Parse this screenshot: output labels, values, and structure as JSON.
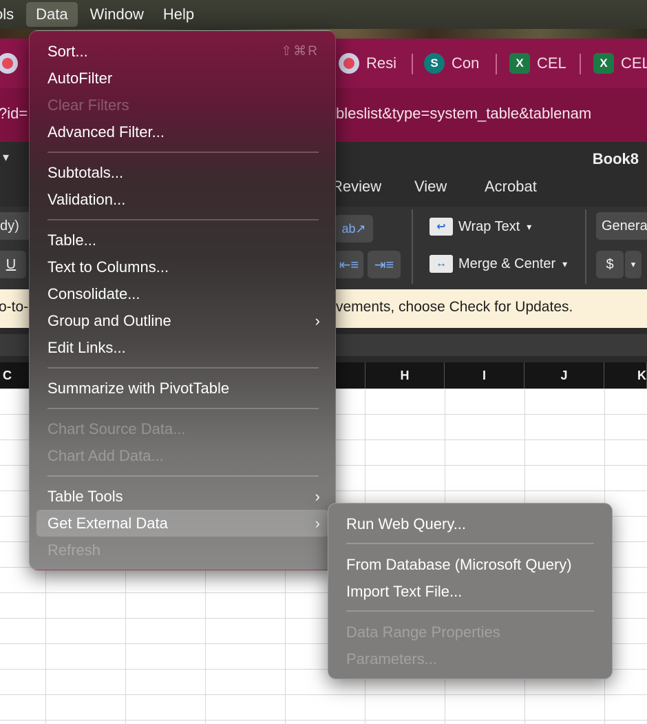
{
  "menubar": {
    "items": [
      "ols",
      "Data",
      "Window",
      "Help"
    ],
    "active_index": 1
  },
  "browser": {
    "tabs": [
      {
        "label": "",
        "icon": "app-icon"
      },
      {
        "label": "Resi",
        "icon": "app-icon"
      },
      {
        "label": "Con",
        "icon": "sharepoint-icon",
        "glyph": "S"
      },
      {
        "label": "CEL",
        "icon": "excel-icon",
        "glyph": "X"
      },
      {
        "label": "CEL",
        "icon": "excel-icon",
        "glyph": "X"
      }
    ],
    "url_left": "?id=",
    "url_right": "bleslist&type=system_table&tablenam"
  },
  "excel": {
    "title": "Book8",
    "ribbon_tabs": [
      "Review",
      "View",
      "Acrobat"
    ],
    "font_fragment": "dy)",
    "underline_label": "U",
    "wrap_text": "Wrap Text",
    "merge_center": "Merge & Center",
    "number_format": "Genera",
    "currency": "$",
    "notice_left": "o-to-",
    "notice_right": "vements, choose Check for Updates.",
    "columns": [
      "C",
      "H",
      "I",
      "J",
      "K"
    ]
  },
  "data_menu": {
    "items": [
      {
        "label": "Sort...",
        "shortcut": "⇧⌘R",
        "enabled": true
      },
      {
        "label": "AutoFilter",
        "enabled": true
      },
      {
        "label": "Clear Filters",
        "enabled": false
      },
      {
        "label": "Advanced Filter...",
        "enabled": true
      },
      {
        "label": "Subtotals...",
        "enabled": true
      },
      {
        "label": "Validation...",
        "enabled": true
      },
      {
        "label": "Table...",
        "enabled": true
      },
      {
        "label": "Text to Columns...",
        "enabled": true
      },
      {
        "label": "Consolidate...",
        "enabled": true
      },
      {
        "label": "Group and Outline",
        "enabled": true,
        "submenu": true
      },
      {
        "label": "Edit Links...",
        "enabled": true
      },
      {
        "label": "Summarize with PivotTable",
        "enabled": true
      },
      {
        "label": "Chart Source Data...",
        "enabled": false
      },
      {
        "label": "Chart Add Data...",
        "enabled": false
      },
      {
        "label": "Table Tools",
        "enabled": true,
        "submenu": true
      },
      {
        "label": "Get External Data",
        "enabled": true,
        "submenu": true,
        "highlighted": true
      },
      {
        "label": "Refresh",
        "enabled": false
      }
    ]
  },
  "external_data_submenu": {
    "items": [
      {
        "label": "Run Web Query...",
        "enabled": true
      },
      {
        "label": "From Database (Microsoft Query)",
        "enabled": true
      },
      {
        "label": "Import Text File...",
        "enabled": true
      },
      {
        "label": "Data Range Properties",
        "enabled": false
      },
      {
        "label": "Parameters...",
        "enabled": false
      }
    ]
  },
  "glyphs": {
    "chevron_right": "›",
    "chevron_down": "▾"
  }
}
